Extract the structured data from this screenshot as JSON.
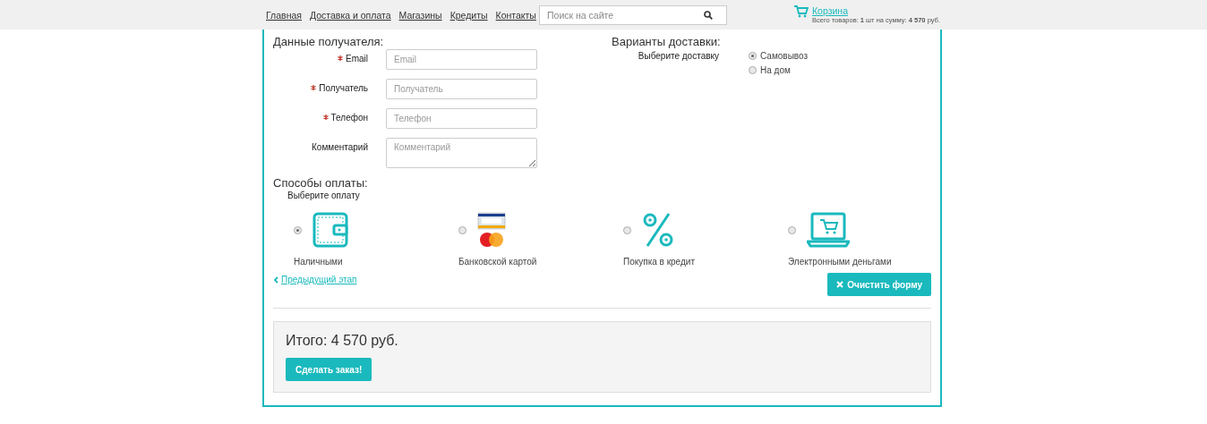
{
  "nav": [
    "Главная",
    "Доставка и оплата",
    "Магазины",
    "Кредиты",
    "Контакты"
  ],
  "search": {
    "placeholder": "Поиск на сайте"
  },
  "cart": {
    "title": "Корзина",
    "summary": "Всего товаров: **1** шт на сумму: **4 570** руб."
  },
  "recipient": {
    "title": "Данные получателя:",
    "fields": [
      {
        "label": "Email",
        "required": true,
        "placeholder": "Email",
        "kind": "input"
      },
      {
        "label": "Получатель",
        "required": true,
        "placeholder": "Получатель",
        "kind": "input"
      },
      {
        "label": "Телефон",
        "required": true,
        "placeholder": "Телефон",
        "kind": "input"
      },
      {
        "label": "Комментарий",
        "required": false,
        "placeholder": "Комментарий",
        "kind": "textarea"
      }
    ]
  },
  "delivery": {
    "title": "Варианты доставки:",
    "label": "Выберите доставку",
    "options": [
      {
        "label": "Самовывоз",
        "selected": true
      },
      {
        "label": "На дом",
        "selected": false
      }
    ]
  },
  "payment": {
    "title": "Способы оплаты:",
    "label": "Выберите оплату",
    "methods": [
      {
        "label": "Наличными",
        "kind": "wallet",
        "selected": true
      },
      {
        "label": "Банковской картой",
        "kind": "cards",
        "selected": false
      },
      {
        "label": "Покупка в кредит",
        "kind": "percent",
        "selected": false
      },
      {
        "label": "Электронными деньгами",
        "kind": "laptop",
        "selected": false
      }
    ]
  },
  "back_link": "Предыдущий этап",
  "clear_button": "Очистить форму",
  "total": "Итого: 4 570 руб.",
  "order_button": "Сделать заказ!"
}
